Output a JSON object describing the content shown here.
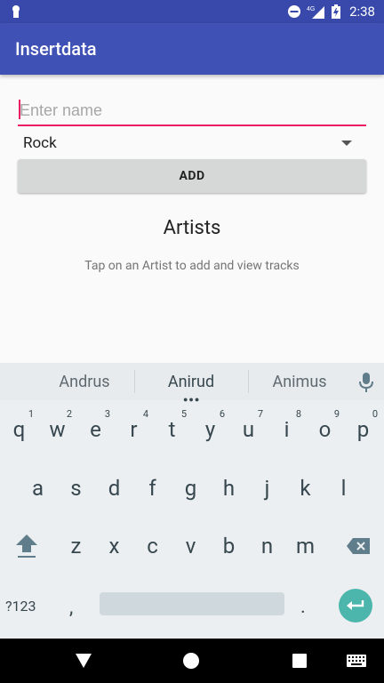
{
  "status_bar": {
    "time": "2:38",
    "network": "4G",
    "icons": [
      "notification-icon",
      "do-not-disturb-icon",
      "signal-icon",
      "battery-icon"
    ]
  },
  "app": {
    "title": "Insertdata",
    "primary_color": "#3f51b5",
    "status_color": "#3949ab",
    "accent_color": "#e91e63"
  },
  "form": {
    "name_placeholder": "Enter name",
    "name_value": "",
    "genre_selected": "Rock",
    "add_label": "ADD"
  },
  "artists": {
    "heading": "Artists",
    "hint": "Tap on an Artist to add and view tracks"
  },
  "keyboard": {
    "suggestions": [
      "Andrus",
      "Anirud",
      "Animus"
    ],
    "row1": [
      "q",
      "w",
      "e",
      "r",
      "t",
      "y",
      "u",
      "i",
      "o",
      "p"
    ],
    "row1_nums": [
      "1",
      "2",
      "3",
      "4",
      "5",
      "6",
      "7",
      "8",
      "9",
      "0"
    ],
    "row2": [
      "a",
      "s",
      "d",
      "f",
      "g",
      "h",
      "j",
      "k",
      "l"
    ],
    "row3": [
      "z",
      "x",
      "c",
      "v",
      "b",
      "n",
      "m"
    ],
    "sym_label": "?123",
    "comma": ",",
    "period": ".",
    "enter_color": "#4db6ac"
  },
  "nav_bar": {
    "buttons": [
      "back-icon",
      "home-icon",
      "recents-icon",
      "keyboard-switch-icon"
    ]
  }
}
